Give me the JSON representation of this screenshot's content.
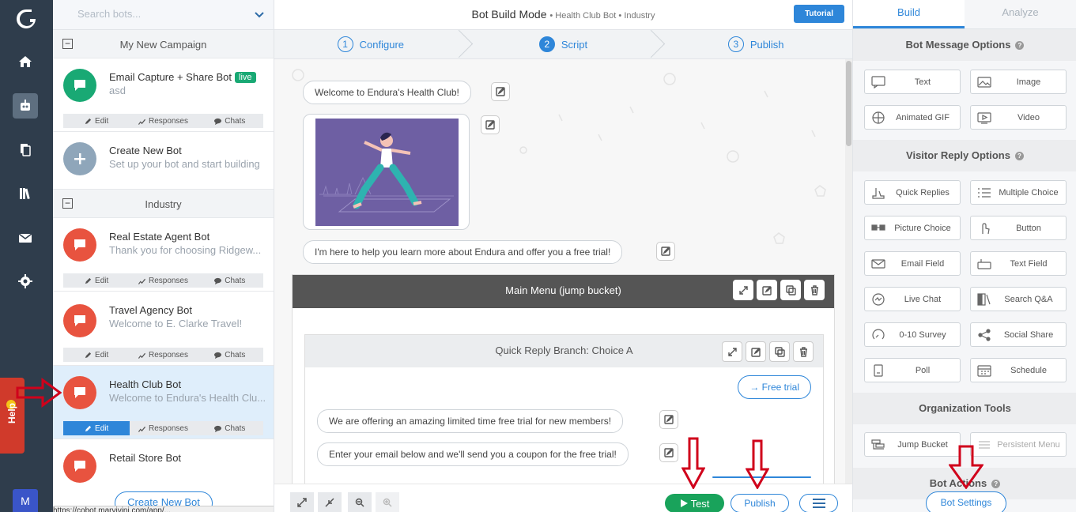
{
  "nav": {
    "items": [
      "home",
      "bots",
      "pages",
      "library",
      "mail",
      "settings"
    ],
    "help_label": "Help",
    "user_initial": "M"
  },
  "list": {
    "search_placeholder": "Search bots...",
    "group1": "My New Campaign",
    "bot1": {
      "name": "Email Capture + Share Bot",
      "badge": "live",
      "desc": "asd"
    },
    "create": {
      "name": "Create New Bot",
      "desc": "Set up your bot and start building"
    },
    "group2": "Industry",
    "bot2": {
      "name": "Real Estate Agent Bot",
      "desc": "Thank you for choosing Ridgew..."
    },
    "bot3": {
      "name": "Travel Agency Bot",
      "desc": "Welcome to E. Clarke Travel!"
    },
    "bot4": {
      "name": "Health Club Bot",
      "desc": "Welcome to Endura's Health Clu..."
    },
    "bot5": {
      "name": "Retail Store Bot",
      "desc": ""
    },
    "actions": {
      "edit": "Edit",
      "responses": "Responses",
      "chats": "Chats"
    },
    "create_button": "Create New Bot",
    "status_text": "https://cobot.marvivini.com/app/..."
  },
  "header": {
    "mode": "Bot Build Mode",
    "bot": "Health Club Bot",
    "group": "Industry",
    "tutorial": "Tutorial"
  },
  "steps": [
    {
      "n": "1",
      "label": "Configure"
    },
    {
      "n": "2",
      "label": "Script"
    },
    {
      "n": "3",
      "label": "Publish"
    }
  ],
  "canvas": {
    "msg1": "Welcome to Endura's Health Club!",
    "msg2": "I'm here to help you learn more about Endura and offer you a free trial!",
    "bucket_title": "Main Menu (jump bucket)",
    "branch_title": "Quick Reply Branch: Choice A",
    "free_trial": "→ Free trial",
    "msg3": "We are offering an amazing limited time free trial for new members!",
    "msg4": "Enter your email below and we'll send you a coupon for the free trial!"
  },
  "bottom": {
    "test": "Test",
    "publish": "Publish"
  },
  "right": {
    "tab_build": "Build",
    "tab_analyze": "Analyze",
    "sec1": "Bot Message Options",
    "msg_opts": [
      "Text",
      "Image",
      "Animated GIF",
      "Video"
    ],
    "sec2": "Visitor Reply Options",
    "reply_opts": [
      "Quick Replies",
      "Multiple Choice",
      "Picture Choice",
      "Button",
      "Email Field",
      "Text Field",
      "Live Chat",
      "Search Q&A",
      "0-10 Survey",
      "Social Share",
      "Poll",
      "Schedule"
    ],
    "sec3": "Organization Tools",
    "org_opts": [
      "Jump Bucket",
      "Persistent Menu"
    ],
    "sec4": "Bot Actions",
    "bot_settings": "Bot Settings"
  },
  "colors": {
    "primary": "#2e86d9",
    "nav": "#2f3d4c",
    "bot_red": "#e8533f",
    "bot_green": "#19a974",
    "annotation": "#d0021b"
  }
}
